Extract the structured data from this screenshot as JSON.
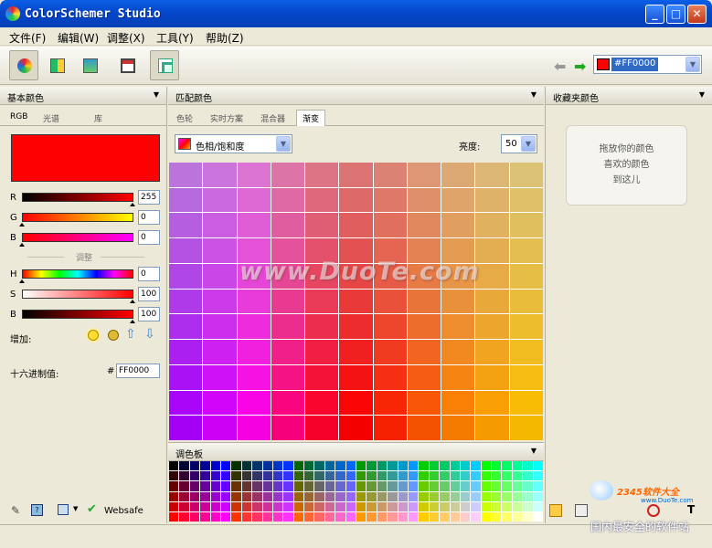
{
  "window": {
    "title": "ColorSchemer Studio",
    "buttons": [
      "_",
      "□",
      "✕"
    ]
  },
  "menu": [
    {
      "label": "文件(F)"
    },
    {
      "label": "编辑(W)"
    },
    {
      "label": "调整(X)"
    },
    {
      "label": "工具(Y)"
    },
    {
      "label": "帮助(Z)"
    }
  ],
  "toolbar": {
    "current_color": "#FF0000",
    "swatch_color": "#ff0000"
  },
  "basic": {
    "title": "基本颜色",
    "tabs": [
      "RGB",
      "光谱",
      "库"
    ],
    "preview_color": "#ff0000",
    "rgb": [
      {
        "label": "R",
        "value": "255"
      },
      {
        "label": "G",
        "value": "0"
      },
      {
        "label": "B",
        "value": "0"
      }
    ],
    "adjust_label": "调整",
    "hsb": [
      {
        "label": "H",
        "value": "0"
      },
      {
        "label": "S",
        "value": "100"
      },
      {
        "label": "B",
        "value": "100"
      }
    ],
    "add_label": "增加:",
    "hex_label": "十六进制值:",
    "hex_hash": "#",
    "hex_value": "FF0000",
    "websafe_label": "Websafe"
  },
  "match": {
    "title": "匹配颜色",
    "tabs": [
      "色轮",
      "实时方案",
      "混合器",
      "渐变"
    ],
    "mode": "色相/饱和度",
    "brightness_label": "亮度:",
    "brightness_value": "50"
  },
  "watermark": "www.DuoTe.com",
  "palette": {
    "title": "调色板"
  },
  "favorites": {
    "title": "收藏夹颜色",
    "placeholder_lines": [
      "拖放你的颜色",
      "喜欢的颜色",
      "到这儿"
    ]
  },
  "brand": {
    "logo_text": "2345软件大全",
    "logo_url": "www.DuoTe.com",
    "caption": "国内最安全的软件站"
  }
}
